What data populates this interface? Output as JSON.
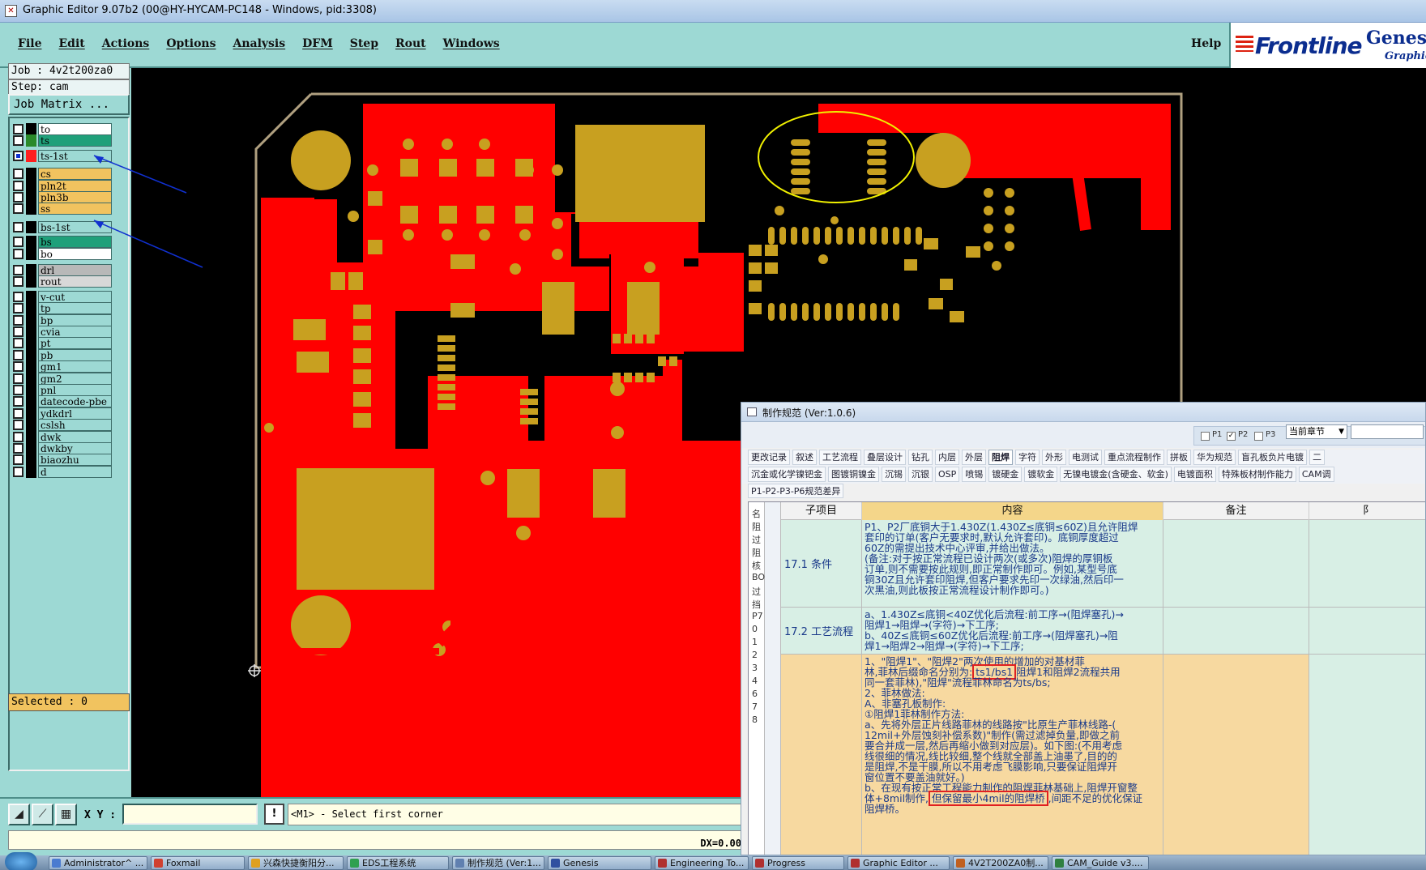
{
  "window": {
    "title": "Graphic Editor 9.07b2 (00@HY-HYCAM-PC148 - Windows, pid:3308)"
  },
  "menu": {
    "items": [
      "File",
      "Edit",
      "Actions",
      "Options",
      "Analysis",
      "DFM",
      "Step",
      "Rout",
      "Windows"
    ],
    "help": "Help"
  },
  "brand": {
    "logo": "Frontline",
    "product": "Genesis",
    "subtitle": "Graphic"
  },
  "job": {
    "job_line": "Job : 4v2t200za0",
    "step_line": "Step: cam",
    "matrix_button": "Job Matrix ..."
  },
  "layers": [
    {
      "name": "to",
      "swatch": "#000000",
      "fill": "#ffffff",
      "selected": false
    },
    {
      "name": "ts",
      "swatch": "#2a8a2a",
      "fill": "#1fa07a",
      "selected": false
    },
    {
      "name": "ts-1st",
      "swatch": "#ff2020",
      "fill": "#9dd9d4",
      "selected": true
    },
    {
      "name": "cs",
      "swatch": "#000000",
      "fill": "#f1c35f",
      "selected": false
    },
    {
      "name": "pln2t",
      "swatch": "#000000",
      "fill": "#f1c35f",
      "selected": false
    },
    {
      "name": "pln3b",
      "swatch": "#000000",
      "fill": "#f1c35f",
      "selected": false
    },
    {
      "name": "ss",
      "swatch": "#000000",
      "fill": "#f1c35f",
      "selected": false
    },
    {
      "name": "bs-1st",
      "swatch": "#000000",
      "fill": "#9dd9d4",
      "selected": false
    },
    {
      "name": "bs",
      "swatch": "#000000",
      "fill": "#1fa07a",
      "selected": false
    },
    {
      "name": "bo",
      "swatch": "#000000",
      "fill": "#ffffff",
      "selected": false
    },
    {
      "name": "drl",
      "swatch": "#000000",
      "fill": "#b8b8b8",
      "selected": false
    },
    {
      "name": "rout",
      "swatch": "#000000",
      "fill": "#d8d8d8",
      "selected": false
    },
    {
      "name": "v-cut",
      "swatch": "#000000",
      "fill": "#9dd9d4",
      "selected": false
    },
    {
      "name": "tp",
      "swatch": "#000000",
      "fill": "#9dd9d4",
      "selected": false
    },
    {
      "name": "bp",
      "swatch": "#000000",
      "fill": "#9dd9d4",
      "selected": false
    },
    {
      "name": "cvia",
      "swatch": "#000000",
      "fill": "#9dd9d4",
      "selected": false
    },
    {
      "name": "pt",
      "swatch": "#000000",
      "fill": "#9dd9d4",
      "selected": false
    },
    {
      "name": "pb",
      "swatch": "#000000",
      "fill": "#9dd9d4",
      "selected": false
    },
    {
      "name": "gm1",
      "swatch": "#000000",
      "fill": "#9dd9d4",
      "selected": false
    },
    {
      "name": "gm2",
      "swatch": "#000000",
      "fill": "#9dd9d4",
      "selected": false
    },
    {
      "name": "pnl",
      "swatch": "#000000",
      "fill": "#9dd9d4",
      "selected": false
    },
    {
      "name": "datecode-pbe",
      "swatch": "#000000",
      "fill": "#9dd9d4",
      "selected": false
    },
    {
      "name": "ydkdrl",
      "swatch": "#000000",
      "fill": "#9dd9d4",
      "selected": false
    },
    {
      "name": "cslsh",
      "swatch": "#000000",
      "fill": "#9dd9d4",
      "selected": false
    },
    {
      "name": "dwk",
      "swatch": "#000000",
      "fill": "#9dd9d4",
      "selected": false
    },
    {
      "name": "dwkby",
      "swatch": "#000000",
      "fill": "#9dd9d4",
      "selected": false
    },
    {
      "name": "biaozhu",
      "swatch": "#000000",
      "fill": "#9dd9d4",
      "selected": false
    },
    {
      "name": "d",
      "swatch": "#000000",
      "fill": "#9dd9d4",
      "selected": false
    }
  ],
  "status": {
    "selected": "Selected : 0",
    "xy_label": "X Y :",
    "excl": "!",
    "prompt": "<M1> - Select first corner",
    "dx": "DX=0.00"
  },
  "spec": {
    "title": "制作规范 (Ver:1.0.6)",
    "checks": [
      {
        "label": "P1",
        "checked": false
      },
      {
        "label": "P2",
        "checked": true
      },
      {
        "label": "P3",
        "checked": false
      }
    ],
    "chapter": "当前章节",
    "tabs_row1": [
      "更改记录",
      "叙述",
      "工艺流程",
      "叠层设计",
      "钻孔",
      "内层",
      "外层",
      "阻焊",
      "字符",
      "外形",
      "电测试",
      "重点流程制作",
      "拼板",
      "华为规范",
      "盲孔板负片电镀",
      "二"
    ],
    "active_tab": "阻焊",
    "tabs_row2": [
      "沉金或化学镍钯金",
      "图镀铜镍金",
      "沉锡",
      "沉银",
      "OSP",
      "喷锡",
      "镀硬金",
      "镀软金",
      "无镍电镀金(含硬金、软金)",
      "电镀面积",
      "特殊板材制作能力",
      "CAM调"
    ],
    "sub_tab": "P1-P2-P3-P6规范差异",
    "headers": {
      "sub": "子项目",
      "content": "内容",
      "note": "备注",
      "extra": "阝"
    },
    "side_chars": [
      "名",
      "阻",
      "过",
      "阻",
      "核",
      "BO",
      "过",
      "挡",
      "P7",
      "0",
      "1",
      "2",
      "3",
      "4",
      "6",
      "7",
      "8"
    ],
    "rows": [
      {
        "sub": "17.1 条件",
        "lines": [
          "P1、P2厂底铜大于1.430Z(1.430Z≤底铜≤60Z)且允许阻焊",
          "套印的订单(客户无要求时,默认允许套印)。底铜厚度超过",
          "60Z的需提出技术中心评审,并给出做法。",
          "(备注:对于按正常流程已设计两次(或多次)阻焊的厚铜板",
          "订单,则不需要按此规则,即正常制作即可。例如,某型号底",
          "铜30Z且允许套印阻焊,但客户要求先印一次绿油,然后印一",
          "次黑油,则此板按正常流程设计制作即可。)"
        ]
      },
      {
        "sub": "17.2 工艺流程",
        "lines": [
          "a、1.430Z≤底铜<40Z优化后流程:前工序→(阻焊塞孔)→",
          "阻焊1→阻焊→(字符)→下工序;",
          "b、40Z≤底铜≤60Z优化后流程:前工序→(阻焊塞孔)→阻",
          "焊1→阻焊2→阻焊→(字符)→下工序;"
        ]
      },
      {
        "sub": "",
        "line1_pre": "1、\"阻焊1\"、\"阻焊2\"两次使用的增加的对基材菲",
        "line2_pre": "林,菲林后缀命名分别为:",
        "highlight1": "ts1/bs1",
        "line2_post": "阻焊1和阻焊2流程共用",
        "lines_a": [
          "同一套菲林),\"阻焊\"流程菲林命名为ts/bs;",
          "2、菲林做法:",
          "A、非塞孔板制作:",
          "①阻焊1菲林制作方法:",
          "a、先将外层正片线路菲林的线路按\"比原生产菲林线路-(",
          "12mil+外层蚀刻补偿系数)\"制作(需过滤掉负量,即做之前",
          "要合并成一层,然后再缩小做到对应层)。如下图:(不用考虑",
          "线很细的情况,线比较细,整个线就全部盖上油墨了,目的的",
          "是阻焊,不是干膜,所以不用考虑飞膜影响,只要保证阻焊开",
          "窗位置不要盖油就好。)",
          "b、在现有按正常工程能力制作的阻焊菲林基础上,阻焊开窗整"
        ],
        "line_last_pre": "体+8mil制作,",
        "highlight2": "但保留最小4mil的阻焊桥",
        "line_last_post": ",间距不足的优化保证",
        "line_final": "阻焊桥。"
      }
    ]
  },
  "taskbar": [
    {
      "label": "Administrator^ ...",
      "color": "#4a7bd0"
    },
    {
      "label": "Foxmail",
      "color": "#d04030"
    },
    {
      "label": "兴森快捷衡阳分...",
      "color": "#e0a020"
    },
    {
      "label": "EDS工程系统",
      "color": "#30a050"
    },
    {
      "label": "制作规范 (Ver:1...",
      "color": "#6080b0"
    },
    {
      "label": "Genesis",
      "color": "#3050a0"
    },
    {
      "label": "Engineering To...",
      "color": "#b03030"
    },
    {
      "label": "Progress",
      "color": "#b03030"
    },
    {
      "label": "Graphic Editor ...",
      "color": "#b03030"
    },
    {
      "label": "4V2T200ZA0制...",
      "color": "#c06020"
    },
    {
      "label": "CAM_Guide v3....",
      "color": "#308040"
    }
  ]
}
